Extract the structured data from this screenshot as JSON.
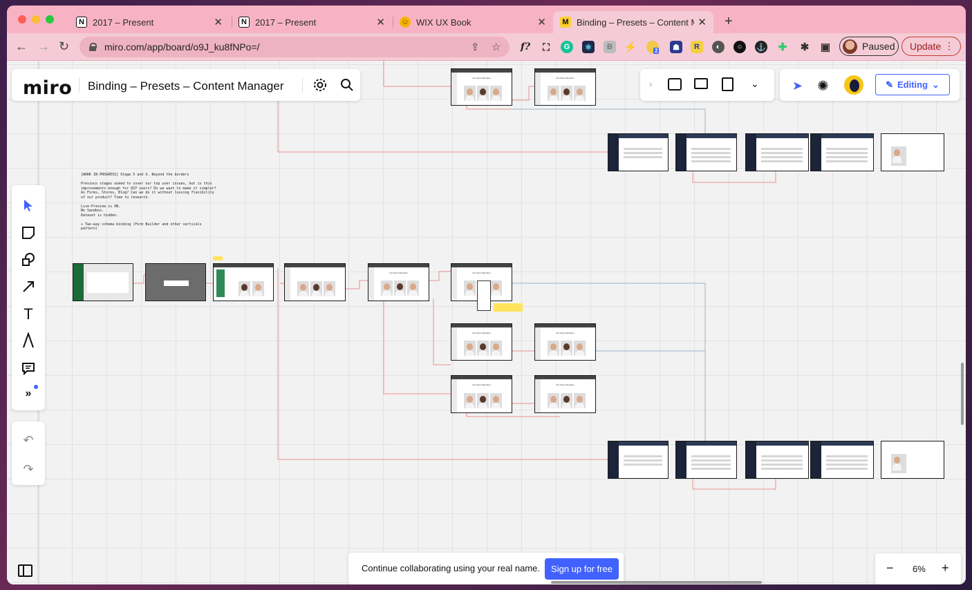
{
  "browser": {
    "tabs": [
      {
        "title": "2017 – Present",
        "icon": "notion-icon"
      },
      {
        "title": "2017 – Present",
        "icon": "notion-icon"
      },
      {
        "title": "WIX UX Book",
        "icon": "emoji-face-icon"
      },
      {
        "title": "Binding – Presets – Content Ma",
        "icon": "miro-icon",
        "active": true
      }
    ],
    "url": "miro.com/app/board/o9J_ku8fNPo=/",
    "profile_label": "Paused",
    "update_label": "Update",
    "extension_badge": "2"
  },
  "miro": {
    "logo": "miro",
    "board_title": "Binding – Presets – Content Manager",
    "editing_label": "Editing",
    "note_text": "[WORK IN PROGRESS] Stage 5 and X. Beyond the borders\n\nPrevious stages aimed to cover our top user issues, but is this improvements enough for DIY users? Do we want to make it simpler? As Forms, Stores, Blog? Can we do it without loosing flexibility of our product? Time to research.\n\nLive-Preview is ON.\nNo Sandbox.\nDataset is hidden.\n\n+ Two-way schema binding (Form Builder and other verticals pattern)",
    "frame_title": "Our Team Members",
    "signup_message": "Continue collaborating using your real name.",
    "signup_button": "Sign up for free",
    "zoom_level": "6%",
    "zoom_out": "−",
    "zoom_in": "+"
  },
  "colors": {
    "tab_strip": "#f7b3c4",
    "miro_accent": "#4262ff"
  }
}
